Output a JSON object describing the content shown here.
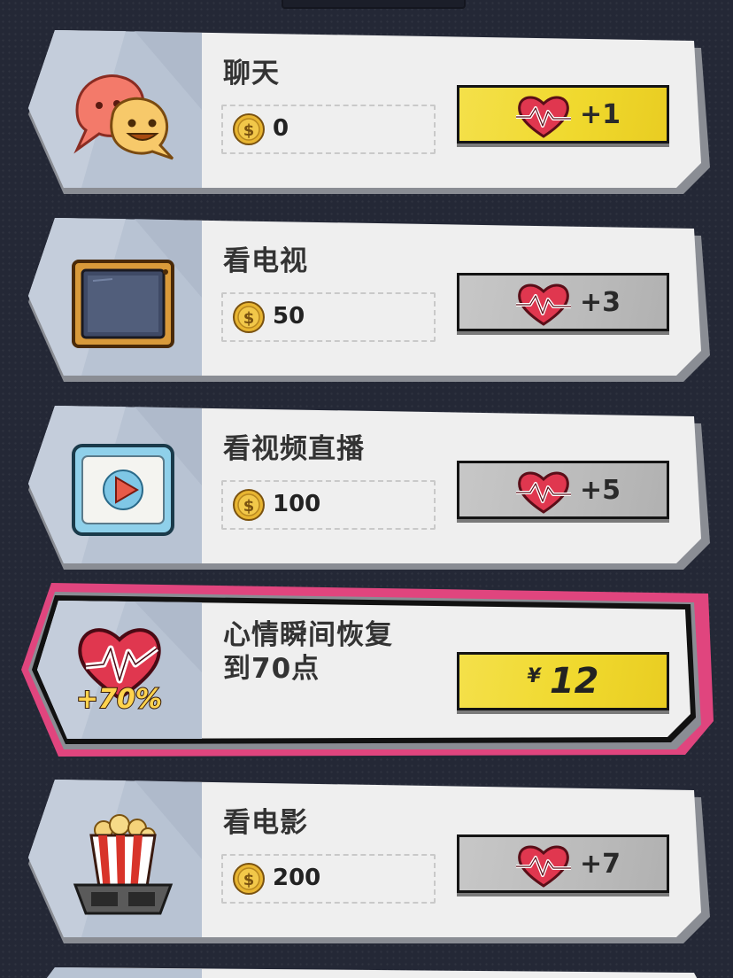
{
  "items": [
    {
      "id": "chat",
      "title": "聊天",
      "cost": "0",
      "reward": "+1",
      "button_style": "yellow",
      "icon": "chat-bubbles-icon"
    },
    {
      "id": "tv",
      "title": "看电视",
      "cost": "50",
      "reward": "+3",
      "button_style": "gray",
      "icon": "television-icon"
    },
    {
      "id": "live",
      "title": "看视频直播",
      "cost": "100",
      "reward": "+5",
      "button_style": "gray",
      "icon": "video-play-icon"
    },
    {
      "id": "mood",
      "title": "心情瞬间恢复\n到70点",
      "badge": "+70%",
      "currency": "¥",
      "price": "12",
      "button_style": "yellow",
      "icon": "heart-pulse-icon",
      "highlight_color": "#e0457e"
    },
    {
      "id": "movie",
      "title": "看电影",
      "cost": "200",
      "reward": "+7",
      "button_style": "gray",
      "icon": "popcorn-glasses-icon"
    }
  ],
  "colors": {
    "yellow": "#f0d92e",
    "gray": "#bbbbbb",
    "heart": "#e0374f",
    "coin": "#e8b531",
    "highlight": "#e0457e"
  }
}
